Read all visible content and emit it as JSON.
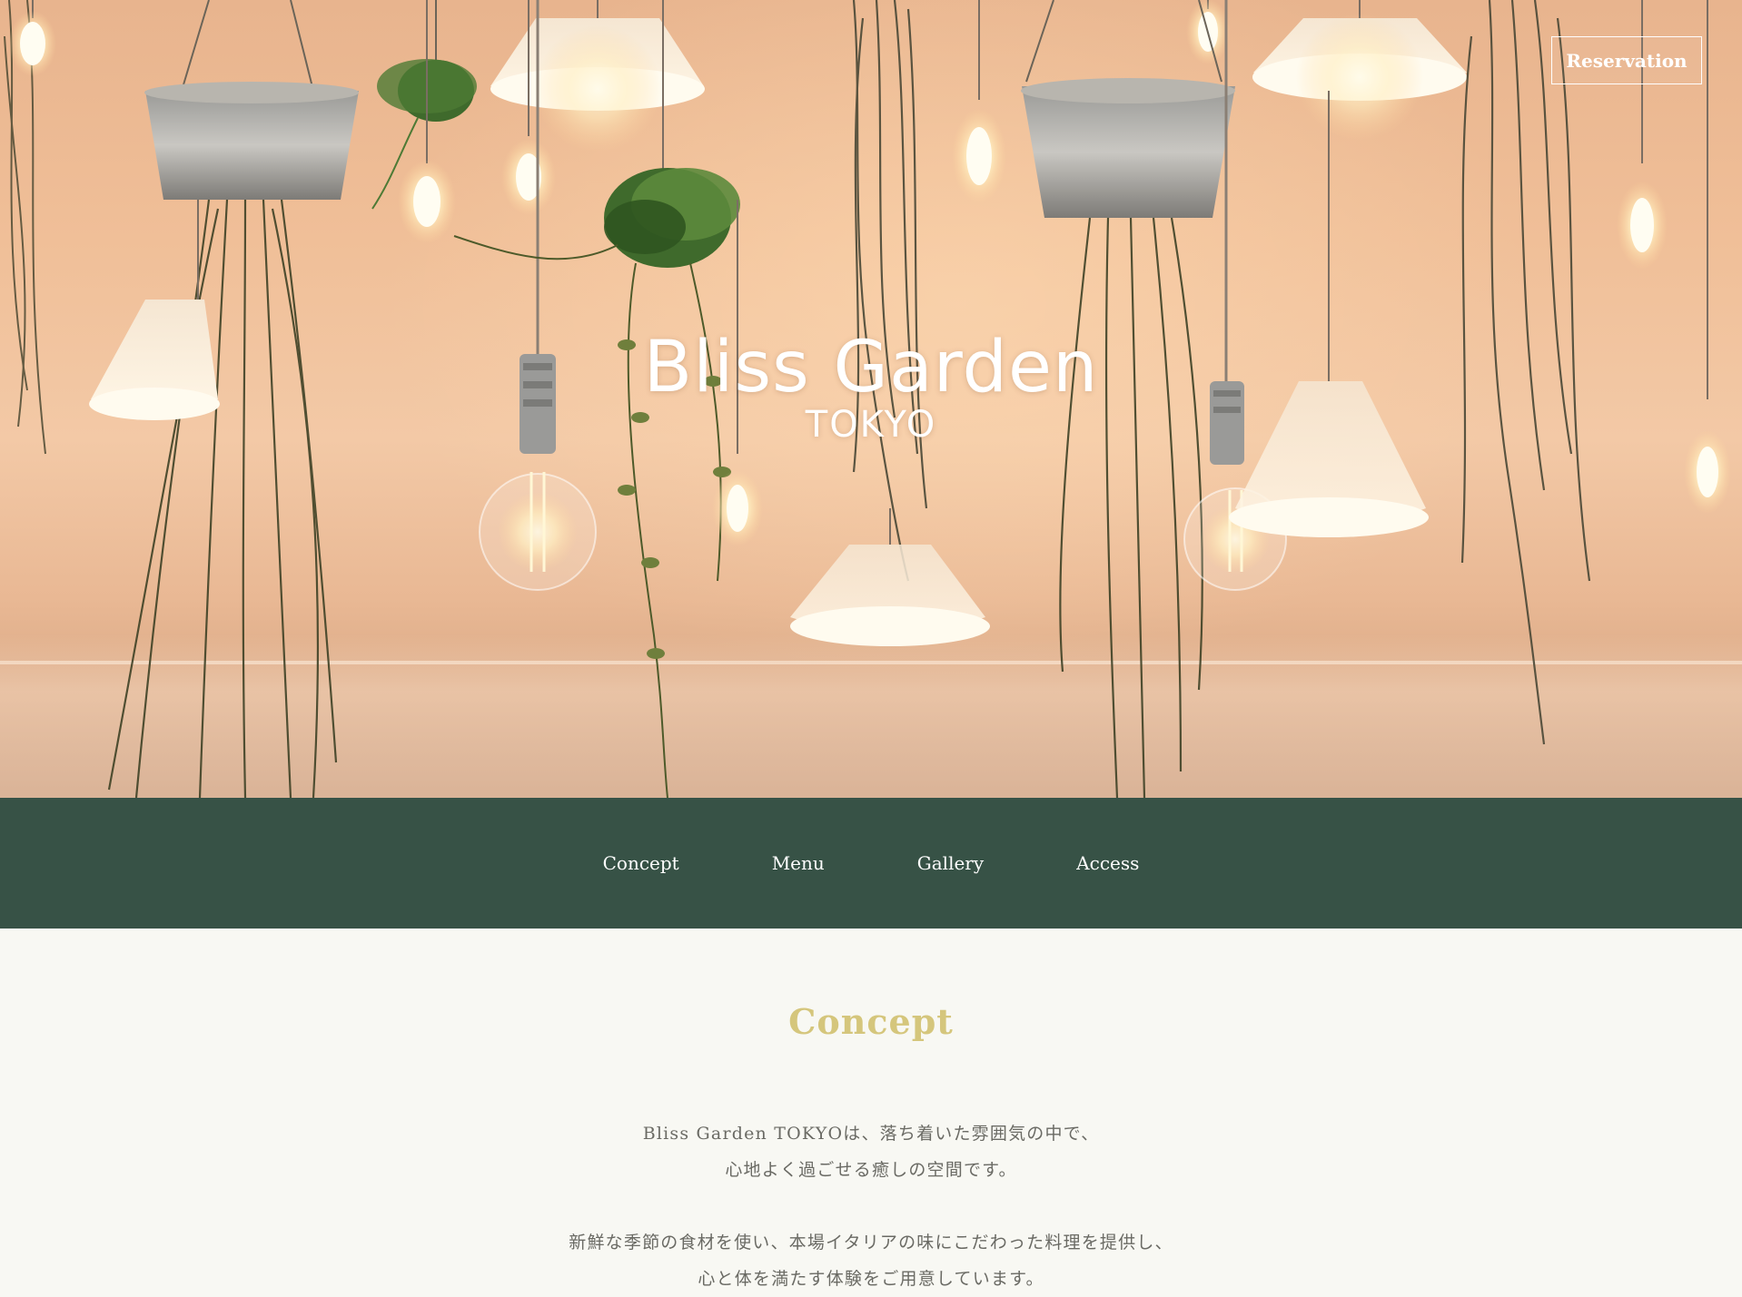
{
  "hero": {
    "brand_title": "Bliss Garden",
    "brand_subtitle": "TOKYO",
    "reservation_label": "Reservation"
  },
  "nav": {
    "items": [
      {
        "label": "Concept"
      },
      {
        "label": "Menu"
      },
      {
        "label": "Gallery"
      },
      {
        "label": "Access"
      }
    ]
  },
  "concept": {
    "title": "Concept",
    "paragraph1": [
      "Bliss Garden TOKYOは、落ち着いた雰囲気の中で、",
      "心地よく過ごせる癒しの空間です。"
    ],
    "paragraph2": [
      "新鮮な季節の食材を使い、本場イタリアの味にこだわった料理を提供し、",
      "心と体を満たす体験をご用意しています。"
    ]
  },
  "colors": {
    "nav_bg": "#375246",
    "accent_gold": "#d5c67c",
    "page_bg": "#f8f8f3",
    "body_text": "#6a6a64"
  }
}
